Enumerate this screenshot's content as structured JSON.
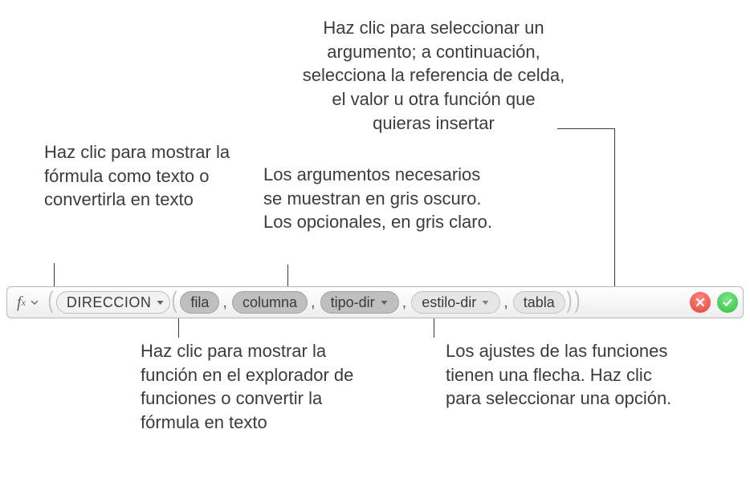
{
  "callouts": {
    "fx": "Haz clic para mostrar la fórmula como texto o convertirla en texto",
    "required_args": "Los argumentos necesarios se muestran en gris oscuro. Los opcionales, en gris claro.",
    "select_arg": "Haz clic para seleccionar un argumento; a continuación, selecciona la referencia de celda, el valor u otra función que quieras insertar",
    "func_dropdown": "Haz clic para mostrar la función en el explorador de funciones o convertir la fórmula en texto",
    "arg_option": "Los ajustes de las funciones tienen una flecha. Haz clic para seleccionar una opción."
  },
  "formula": {
    "function_name": "DIRECCION",
    "args": [
      {
        "label": "fila",
        "kind": "required",
        "has_dropdown": false
      },
      {
        "label": "columna",
        "kind": "required",
        "has_dropdown": false
      },
      {
        "label": "tipo-dir",
        "kind": "required",
        "has_dropdown": true
      },
      {
        "label": "estilo-dir",
        "kind": "optional",
        "has_dropdown": true
      },
      {
        "label": "tabla",
        "kind": "optional",
        "has_dropdown": false
      }
    ]
  }
}
